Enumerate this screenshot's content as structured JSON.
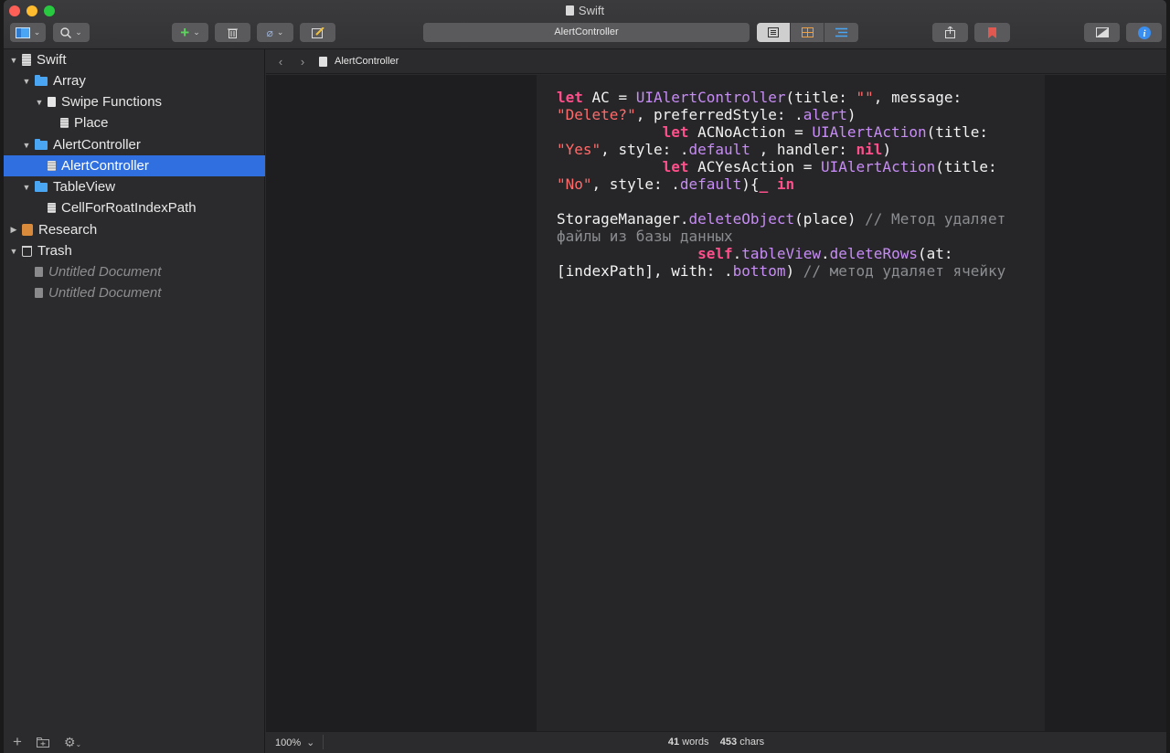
{
  "window": {
    "title": "Swift"
  },
  "toolbar": {
    "path_title": "AlertController"
  },
  "sidebar": {
    "items": [
      {
        "label": "Swift",
        "kind": "project"
      },
      {
        "label": "Array",
        "kind": "folder"
      },
      {
        "label": "Swipe Functions",
        "kind": "group"
      },
      {
        "label": "Place",
        "kind": "document"
      },
      {
        "label": "AlertController",
        "kind": "folder"
      },
      {
        "label": "AlertController",
        "kind": "document",
        "selected": true
      },
      {
        "label": "TableView",
        "kind": "folder"
      },
      {
        "label": "CellForRoatIndexPath",
        "kind": "document"
      },
      {
        "label": "Research",
        "kind": "research"
      },
      {
        "label": "Trash",
        "kind": "trash"
      },
      {
        "label": "Untitled Document",
        "kind": "trashed-document"
      },
      {
        "label": "Untitled Document",
        "kind": "trashed-document"
      }
    ]
  },
  "editor": {
    "breadcrumb": "AlertController",
    "code": {
      "l1": {
        "kw": "let",
        "name": " AC = ",
        "type": "UIAlertController",
        "rest": "(title: ",
        "str": "\"\"",
        "rest2": ", message:"
      },
      "l2": {
        "str": "\"Delete?\"",
        "rest": ", preferredStyle: .",
        "enum": "alert",
        "rest2": ")"
      },
      "l3": {
        "indent": "            ",
        "kw": "let",
        "name": " ACNoAction = ",
        "type": "UIAlertAction",
        "rest": "(title:"
      },
      "l4": {
        "str": "\"Yes\"",
        "rest": ", style: .",
        "enum": "default",
        "rest2": " , handler: ",
        "kw": "nil",
        "rest3": ")"
      },
      "l5": {
        "indent": "            ",
        "kw": "let",
        "name": " ACYesAction = ",
        "type": "UIAlertAction",
        "rest": "(title:"
      },
      "l6": {
        "str": "\"No\"",
        "rest": ", style: .",
        "enum": "default",
        "rest2": "){",
        "kw": "_ in"
      },
      "l7": {
        "name": "StorageManager",
        "dot": ".",
        "fn": "deleteObject",
        "rest": "(place) ",
        "comment": "// Метод удаляет"
      },
      "l8": {
        "comment": "файлы из базы данных"
      },
      "l9": {
        "indent": "                ",
        "kw": "self",
        "dot": ".",
        "fn1": "tableView",
        "dot2": ".",
        "fn2": "deleteRows",
        "rest": "(at:"
      },
      "l10": {
        "rest": "[indexPath], with: .",
        "enum": "bottom",
        "rest2": ") ",
        "comment": "// метод удаляет ячейку"
      }
    }
  },
  "status": {
    "zoom": "100%",
    "words_count": "41",
    "words_label": "words",
    "chars_count": "453",
    "chars_label": "chars"
  },
  "colors": {
    "selection": "#2f6fe0",
    "keyword": "#ff4f8b",
    "type": "#c78cf5",
    "string": "#ff6b6b",
    "comment": "#8b8d91"
  }
}
